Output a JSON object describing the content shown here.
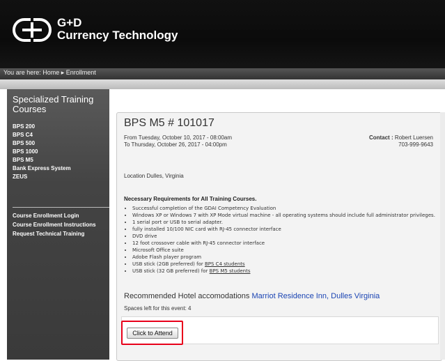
{
  "brand": {
    "line1": "G+D",
    "line2": "Currency Technology"
  },
  "breadcrumb": "You are here: Home ▸ Enrollment",
  "sidebar": {
    "title": "Specialized Training Courses",
    "courses": [
      "BPS 200",
      "BPS C4",
      "BPS 500",
      "BPS 1000",
      "BPS M5",
      "Bank Express System",
      "ZEUS"
    ],
    "links": [
      "Course Enrollment Login",
      "Course Enrollment Instructions",
      "Request Technical Training"
    ]
  },
  "event": {
    "title": "BPS M5 # 101017",
    "from": "From Tuesday, October 10, 2017 -  08:00am",
    "to": "To Thursday, October 26, 2017 - 04:00pm",
    "contact_label": "Contact :",
    "contact_name": "Robert Luersen",
    "contact_phone": "703-999-9643",
    "location": "Location Dulles, Virginia",
    "requirements_title": "Necessary Requirements for All Training Courses.",
    "requirements": [
      "Successful completion of the GDAI Competency Evaluation",
      "Windows XP or Windows 7 with XP Mode virtual machine - all operating systems should include full administrator privileges.",
      "1 serial port or USB to serial adapter.",
      "fully installed 10/100 NIC card with RJ-45 connector interface",
      "DVD drive",
      "12 foot crossover cable with RJ-45 connector interface",
      "Microsoft Office suite",
      "Adobe Flash player program"
    ],
    "usb1_prefix": "USB stick (2GB preferred) for ",
    "usb1_link": "BPS C4 students",
    "usb2_prefix": "USB stick (32 GB preferred) for ",
    "usb2_link": "BPS M5 students",
    "hotel_prefix": "Recommended Hotel accomodations ",
    "hotel_link": "Marriot Residence Inn, Dulles Virginia",
    "spaces": "Spaces left for this event: 4",
    "attend_button": "Click to Attend"
  },
  "colors": {
    "header_bg": "#111111",
    "link_blue": "#1a44b3",
    "highlight_red": "#e8001a"
  }
}
